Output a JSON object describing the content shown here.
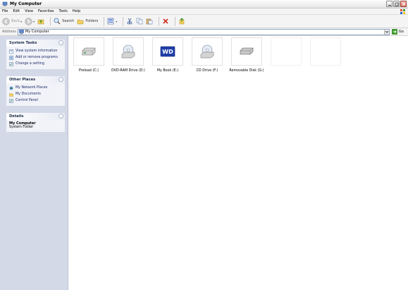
{
  "window": {
    "title": "My Computer"
  },
  "menubar": {
    "items": [
      "File",
      "Edit",
      "View",
      "Favorites",
      "Tools",
      "Help"
    ]
  },
  "toolbar": {
    "back_label": "Back",
    "search_label": "Search",
    "folders_label": "Folders"
  },
  "address": {
    "label": "Address",
    "value": "My Computer",
    "go_label": "Go"
  },
  "taskpane": {
    "system_tasks": {
      "title": "System Tasks",
      "items": [
        "View system information",
        "Add or remove programs",
        "Change a setting"
      ]
    },
    "other_places": {
      "title": "Other Places",
      "items": [
        "My Network Places",
        "My Documents",
        "Control Panel"
      ]
    },
    "details": {
      "title": "Details",
      "name": "My Computer",
      "type": "System Folder"
    }
  },
  "drives": [
    {
      "label": "Preload (C:)",
      "icon": "hard-drive-icon"
    },
    {
      "label": "DVD-RAM Drive (D:)",
      "icon": "dvd-drive-icon"
    },
    {
      "label": "My Book (E:)",
      "icon": "wd-drive-icon"
    },
    {
      "label": "CD Drive (F:)",
      "icon": "cd-drive-icon"
    },
    {
      "label": "Removable Disk (G:)",
      "icon": "removable-disk-icon"
    }
  ]
}
